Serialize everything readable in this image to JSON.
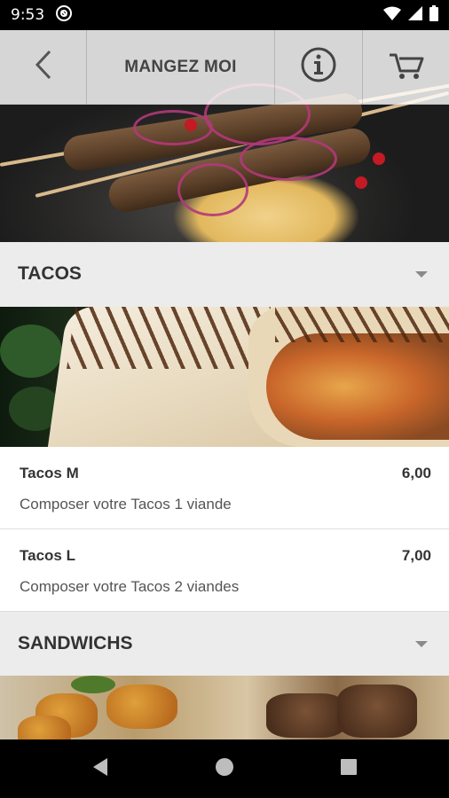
{
  "status_bar": {
    "time": "9:53"
  },
  "toolbar": {
    "title": "MANGEZ MOI"
  },
  "categories": [
    {
      "title": "TACOS",
      "items": [
        {
          "name": "Tacos M",
          "price": "6,00",
          "description": "Composer votre Tacos 1 viande"
        },
        {
          "name": "Tacos L",
          "price": "7,00",
          "description": "Composer votre Tacos 2 viandes"
        }
      ]
    },
    {
      "title": "SANDWICHS",
      "items": []
    }
  ],
  "icons": {
    "back": "arrow-left-icon",
    "info": "info-icon",
    "cart": "cart-icon"
  },
  "colors": {
    "status_bar": "#000000",
    "toolbar_bg": "#ffffffd1",
    "category_bg": "#ececec",
    "item_bg": "#ffffff",
    "text_dark": "#333333"
  }
}
